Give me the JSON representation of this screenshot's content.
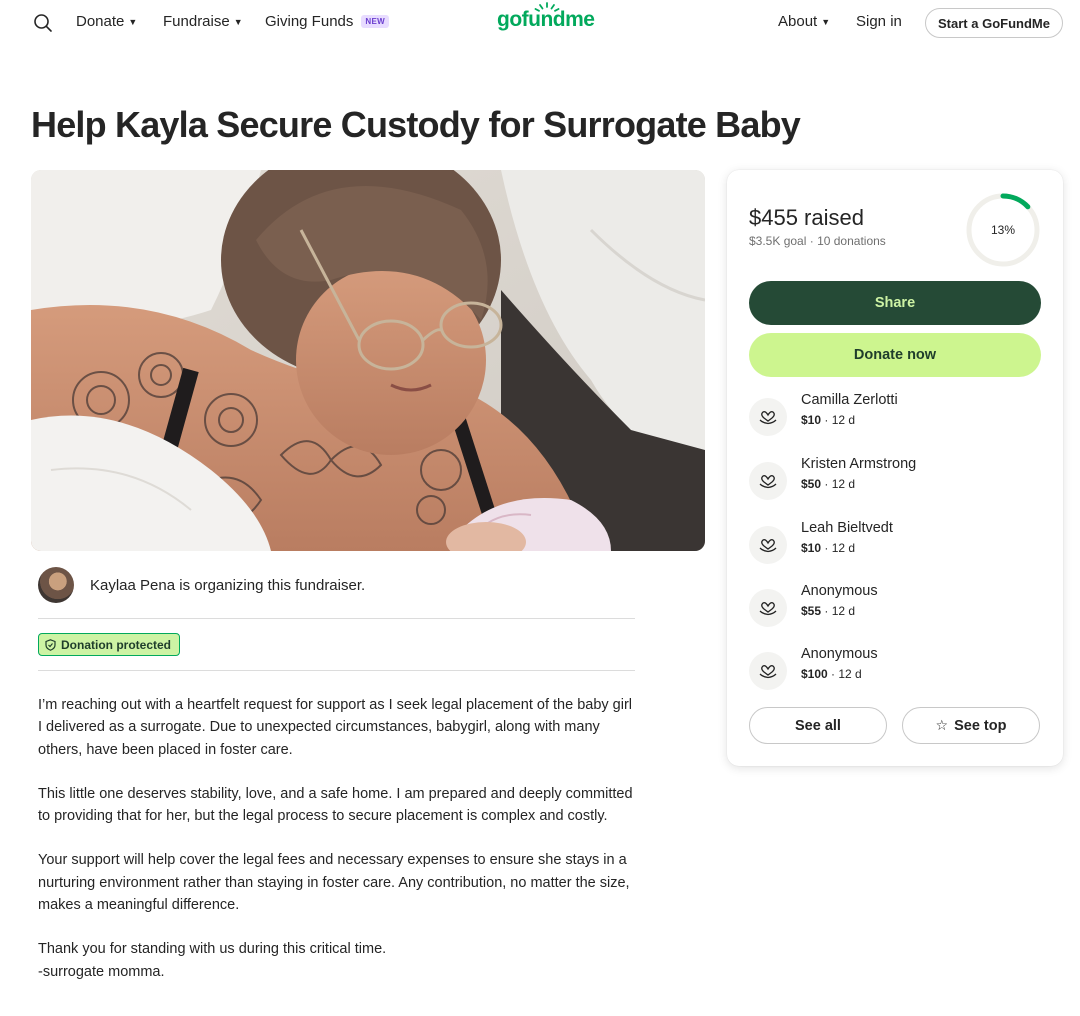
{
  "nav": {
    "donate": "Donate",
    "fundraise": "Fundraise",
    "giving_funds": "Giving Funds",
    "new_badge": "NEW",
    "logo": "gofundme",
    "about": "About",
    "sign_in": "Sign in",
    "start": "Start a GoFundMe"
  },
  "title": "Help Kayla Secure Custody for Surrogate Baby",
  "organizer": {
    "text": "Kaylaa Pena is organizing this fundraiser."
  },
  "protected_label": "Donation protected",
  "story": [
    "I’m reaching out with a heartfelt request for support as I seek legal placement of the baby girl I delivered as a surrogate. Due to unexpected circumstances, babygirl, along with many others, have been placed in foster care.",
    "This little one deserves stability, love, and a safe home. I am prepared and deeply committed to providing that for her, but the legal process to secure placement is complex and costly.",
    "Your support will help cover the legal fees and necessary expenses to ensure she stays in a nurturing environment rather than staying in foster care. Any contribution, no matter the size, makes a meaningful difference.",
    "Thank you for standing with us during this critical time.\n-surrogate momma."
  ],
  "card": {
    "raised": "$455 raised",
    "goal": "$3.5K goal",
    "donations": "10 donations",
    "percent_label": "13%",
    "percent": 13,
    "share": "Share",
    "donate_now": "Donate now",
    "see_all": "See all",
    "see_top": "See top",
    "donors": [
      {
        "name": "Camilla Zerlotti",
        "amount": "$10",
        "time": "12 d"
      },
      {
        "name": "Kristen Armstrong",
        "amount": "$50",
        "time": "12 d"
      },
      {
        "name": "Leah Bieltvedt",
        "amount": "$10",
        "time": "12 d"
      },
      {
        "name": "Anonymous",
        "amount": "$55",
        "time": "12 d"
      },
      {
        "name": "Anonymous",
        "amount": "$100",
        "time": "12 d"
      }
    ]
  },
  "colors": {
    "brand_green": "#02a95c",
    "share_bg": "#254a36",
    "donate_bg": "#cdf58f"
  }
}
